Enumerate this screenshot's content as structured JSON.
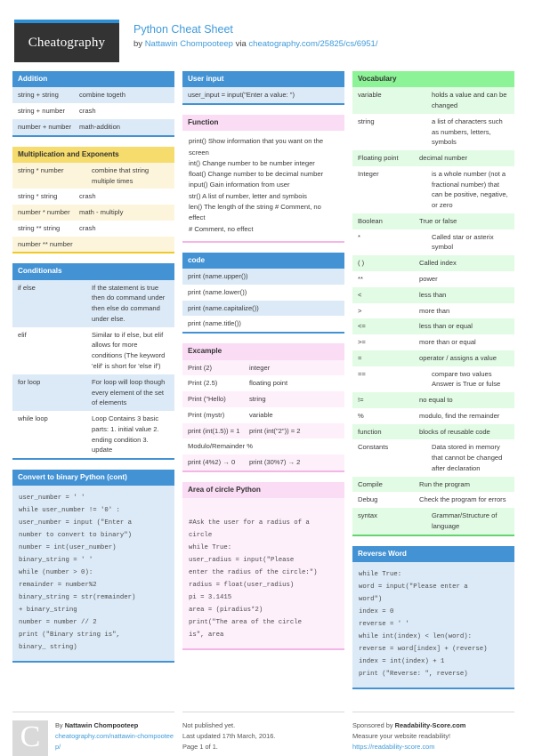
{
  "header": {
    "logo_text": "Cheatography",
    "title": "Python Cheat Sheet",
    "by_prefix": "by ",
    "author": "Nattawin Chompooteep",
    "via": " via ",
    "source_url": "cheatography.com/25825/cs/6951/"
  },
  "columns": [
    {
      "cards": [
        {
          "title": "Addition",
          "theme": "blue",
          "type": "table",
          "rows": [
            {
              "k": "string + string",
              "v": "combine togeth"
            },
            {
              "k": "string + number",
              "v": "crash"
            },
            {
              "k": "number + number",
              "v": "math-addition"
            }
          ]
        },
        {
          "title": "Multiplication and Exponents",
          "theme": "yellow",
          "type": "table",
          "rows": [
            {
              "k": "string * number",
              "v": "combine that string multiple times"
            },
            {
              "k": "string * string",
              "v": "crash"
            },
            {
              "k": "number * number",
              "v": "math - multiply"
            },
            {
              "k": "string ** string",
              "v": "crash"
            },
            {
              "k": "number ** number",
              "v": ""
            }
          ]
        },
        {
          "title": "Conditionals",
          "theme": "blue",
          "type": "table",
          "rows": [
            {
              "k": "if else",
              "v": "If the statement is true then do command under then else do command under else."
            },
            {
              "k": "elif",
              "v": "Similar to if else, but elif allows for more conditions (The keyword 'elif' is short for 'else if')"
            },
            {
              "k": "for loop",
              "v": "For loop will loop though every element of the set of elements"
            },
            {
              "k": "while loop",
              "v": "Loop Contains 3 basic parts: 1. initial value 2. ending condition 3. update"
            }
          ]
        },
        {
          "title": "Convert to binary Python (cont)",
          "theme": "blue",
          "type": "code",
          "code": "user_number = ' '\nwhile user_number != '0' :\nuser_number = input (\"Enter a\nnumber to convert to binary\")\nnumber = int(user_number)\nbinary_string = ' '\nwhile (number > 0):\nremainder = number%2\nbinary_string = str(remainder)\n+ binary_string\nnumber = number // 2\nprint (\"Binary string is\",\nbinary_ string)"
        }
      ]
    },
    {
      "cards": [
        {
          "title": "User input",
          "theme": "blue",
          "type": "table",
          "rows": [
            {
              "k": "user_input = input(\"Enter a value: \")",
              "v": "",
              "full": true
            }
          ]
        },
        {
          "title": "Function",
          "theme": "pink",
          "type": "freetext",
          "lines": [
            "print() Show information that you want on the screen",
            "int() Change number to be number integer",
            "float() Change number to be decimal number",
            "input() Gain information from user",
            "str() A list of number, letter and symbois",
            "len() The length of the string # Comment, no effect",
            "# Comment, no effect"
          ]
        },
        {
          "title": "code",
          "theme": "blue",
          "type": "table",
          "rows": [
            {
              "k": "print (name.upper())",
              "v": "",
              "full": true
            },
            {
              "k": "print (name.lower())",
              "v": "",
              "full": true
            },
            {
              "k": "print (name.capitalize())",
              "v": "",
              "full": true
            },
            {
              "k": "print (name.title())",
              "v": "",
              "full": true
            }
          ]
        },
        {
          "title": "Excample",
          "theme": "pink",
          "type": "table",
          "rows": [
            {
              "k": "Print (2)",
              "v": "integer"
            },
            {
              "k": "Print (2.5)",
              "v": "floating point"
            },
            {
              "k": "Print (\"Hello)",
              "v": "string"
            },
            {
              "k": "Print (mystr)",
              "v": "variable"
            },
            {
              "k": "print (int(1.5)) = 1",
              "v": "print (int(\"2\")) = 2"
            },
            {
              "k": "Modulo/Remainder %",
              "v": "",
              "full": true
            },
            {
              "k": "print (4%2) → 0",
              "v": "print (30%7) → 2"
            }
          ]
        },
        {
          "title": "Area of circle Python",
          "theme": "pink",
          "type": "code",
          "code": "\n#Ask the user for a radius of a\ncircle\nwhile True:\nuser_radius = input(\"Please\nenter the radius of the circle:\")\nradius = float(user_radius)\npi = 3.1415\narea = (piradius*2)\nprint(\"The area of the circle\nis\", area"
        }
      ]
    },
    {
      "cards": [
        {
          "title": "Vocabulary",
          "theme": "green",
          "type": "table",
          "rows": [
            {
              "k": "variable",
              "v": "holds a value and can be changed"
            },
            {
              "k": "string",
              "v": "a list of characters such as numbers, letters, symbols"
            },
            {
              "k": "Floating point",
              "v": "decimal number"
            },
            {
              "k": "Integer",
              "v": "is a whole number (not a fractional number) that can be positive, negative, or zero"
            },
            {
              "k": "Boolean",
              "v": "True or false"
            },
            {
              "k": "*",
              "v": "Called star or asterix symbol"
            },
            {
              "k": "( )",
              "v": "Called index"
            },
            {
              "k": "**",
              "v": "power"
            },
            {
              "k": "<",
              "v": "less than"
            },
            {
              "k": ">",
              "v": "more than"
            },
            {
              "k": "<=",
              "v": "less than or equal"
            },
            {
              "k": ">=",
              "v": "more than or equal"
            },
            {
              "k": "=",
              "v": "operator / assigns a value"
            },
            {
              "k": "==",
              "v": "compare two values Answer is True or fulse"
            },
            {
              "k": "!=",
              "v": "no equal to"
            },
            {
              "k": "%",
              "v": "modulo, find the remainder"
            },
            {
              "k": "function",
              "v": "blocks of reusable code"
            },
            {
              "k": "Constants",
              "v": "Data stored in memory that cannot be changed after declaration"
            },
            {
              "k": "Compile",
              "v": "Run the program"
            },
            {
              "k": "Debug",
              "v": "Check the program for errors"
            },
            {
              "k": "syntax",
              "v": "Grammar/Structure of language"
            }
          ]
        },
        {
          "title": "Reverse Word",
          "theme": "blue",
          "type": "code",
          "code": "while True:\nword = input(\"Please enter a\nword\")\nindex = 0\nreverse = ' '\nwhile int(index) < len(word):\nreverse = word[index] + (reverse)\nindex = int(index) + 1\nprint (\"Reverse: \", reverse)"
        }
      ]
    }
  ],
  "footer": {
    "mark_letter": "C",
    "author_prefix": "By ",
    "author": "Nattawin Chompooteep",
    "author_url": "cheatography.com/nattawin-chompooteep/",
    "publish_status": "Not published yet.",
    "last_updated": "Last updated 17th March, 2016.",
    "page_info": "Page 1 of 1.",
    "sponsor_prefix": "Sponsored by ",
    "sponsor_name": "Readability-Score.com",
    "sponsor_tagline": "Measure your website readability!",
    "sponsor_url": "https://readability-score.com"
  }
}
